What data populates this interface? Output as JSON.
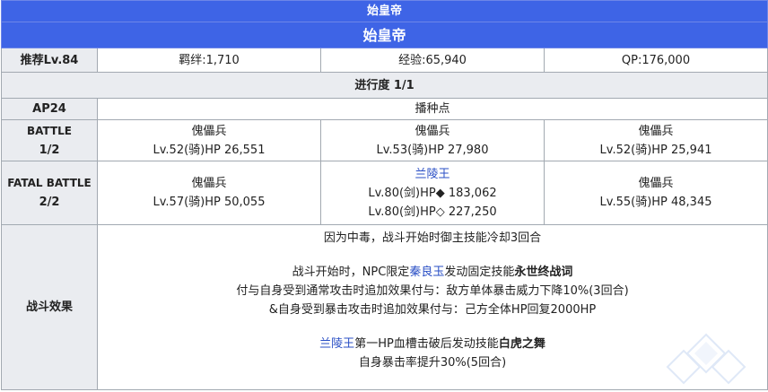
{
  "header": {
    "subtitle": "始皇帝",
    "title": "始皇帝"
  },
  "stats": {
    "recommended_level": "推荐Lv.84",
    "bond": "羁绊:1,710",
    "exp": "经验:65,940",
    "qp": "QP:176,000"
  },
  "progress": "进行度 1/1",
  "ap": {
    "label": "AP24",
    "location": "播种点"
  },
  "battle1": {
    "label_line1": "BATTLE",
    "label_line2": "1/2",
    "enemies": [
      {
        "name": "傀儡兵",
        "stats": "Lv.52(骑)HP 26,551"
      },
      {
        "name": "傀儡兵",
        "stats": "Lv.53(骑)HP 27,980"
      },
      {
        "name": "傀儡兵",
        "stats": "Lv.52(骑)HP 25,941"
      }
    ]
  },
  "battle2": {
    "label_line1": "FATAL BATTLE",
    "label_line2": "2/2",
    "enemy1": {
      "name": "傀儡兵",
      "stats": "Lv.57(骑)HP 50,055"
    },
    "enemy2": {
      "name": "兰陵王",
      "stats_line1": "Lv.80(剑)HP◆ 183,062",
      "stats_line2": "Lv.80(剑)HP◇ 227,250"
    },
    "enemy3": {
      "name": "傀儡兵",
      "stats": "Lv.55(骑)HP 48,345"
    }
  },
  "effects": {
    "label": "战斗效果",
    "line1": "因为中毒，战斗开始时御主技能冷却3回合",
    "line2_pre": "战斗开始时，NPC限定",
    "line2_link": "秦良玉",
    "line2_mid": "发动固定技能",
    "line2_bold": "永世终战词",
    "line3": "付与自身受到通常攻击时追加效果付与：敌方单体暴击威力下降10%(3回合)",
    "line4": "&自身受到暴击攻击时追加效果付与：己方全体HP回复2000HP",
    "line5_link": "兰陵王",
    "line5_mid": "第一HP血槽击破后发动技能",
    "line5_bold": "白虎之舞",
    "line6": "自身暴击率提升30%(5回合)"
  }
}
